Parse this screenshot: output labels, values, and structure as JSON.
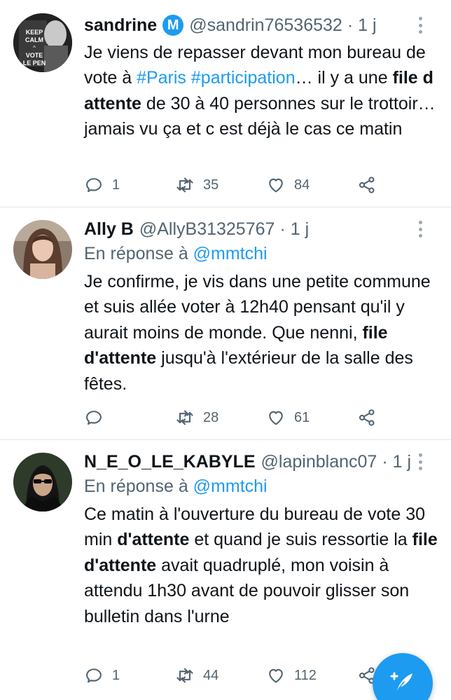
{
  "tweets": [
    {
      "name": "sandrine",
      "badge": "M",
      "handle": "@sandrin76536532",
      "sep": "·",
      "time": "1 j",
      "avatar_caption": "KEEP CALM ^ VOTE LE PEN",
      "text_parts": [
        "Je viens de repasser devant mon bureau de vote à ",
        "#Paris",
        " ",
        "#participation",
        "… il y a une ",
        "file d attente",
        " de 30 à 40 personnes sur le trottoir… jamais vu ça et c est déjà le cas ce matin"
      ],
      "replies": "1",
      "retweets": "35",
      "likes": "84"
    },
    {
      "name": "Ally B",
      "handle": "@AllyB31325767",
      "sep": "·",
      "time": "1 j",
      "reply_prefix": "En réponse à",
      "reply_mention": "@mmtchi",
      "text_parts": [
        "Je confirme, je vis dans une petite commune et suis allée voter à 12h40 pensant qu'il y aurait moins de monde. Que nenni, ",
        "file d'attente",
        " jusqu'à l'extérieur de la salle des fêtes."
      ],
      "replies": "",
      "retweets": "28",
      "likes": "61"
    },
    {
      "name": "N_E_O_LE_KABYLE",
      "handle": "@lapinblanc07",
      "sep": "·",
      "time": "1 j",
      "reply_prefix": "En réponse à",
      "reply_mention": "@mmtchi",
      "text_parts": [
        "Ce matin à l'ouverture du bureau de vote 30 min ",
        "d'attente",
        " et quand je suis ressortie la ",
        "file d'attente",
        " avait quadruplé, mon voisin à attendu 1h30 avant de pouvoir glisser son bulletin dans l'urne"
      ],
      "replies": "1",
      "retweets": "44",
      "likes": "112"
    }
  ],
  "colors": {
    "accent": "#1d9bf0",
    "secondary_text": "#536471",
    "divider": "#e1e6ea"
  },
  "icons": [
    "reply-icon",
    "retweet-icon",
    "like-icon",
    "share-icon",
    "more-icon",
    "compose-tweet-icon"
  ]
}
